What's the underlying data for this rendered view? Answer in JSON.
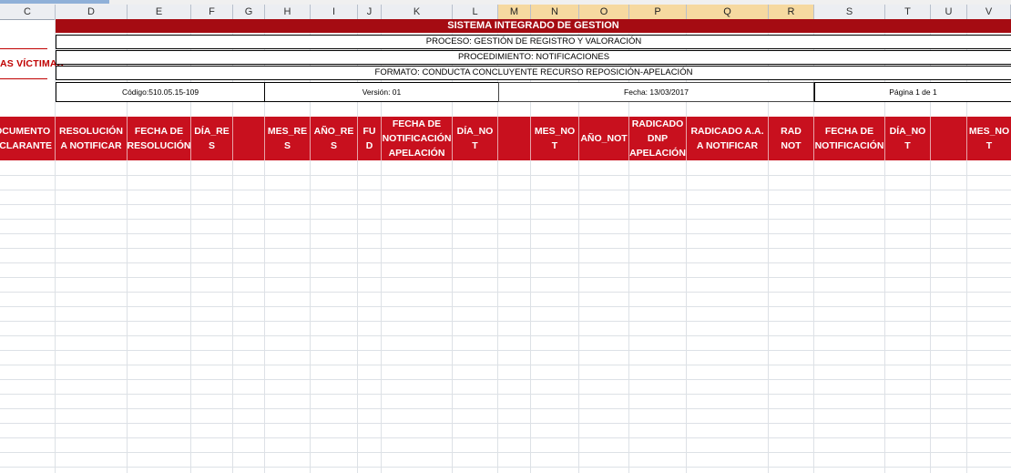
{
  "columns": [
    "C",
    "D",
    "E",
    "F",
    "G",
    "H",
    "I",
    "J",
    "K",
    "L",
    "M",
    "N",
    "O",
    "P",
    "Q",
    "R",
    "S",
    "T",
    "U",
    "V"
  ],
  "highlighted_columns": [
    "M",
    "N",
    "O",
    "P",
    "Q",
    "R"
  ],
  "logo": {
    "text": "AS VÍCTIMAS"
  },
  "header": {
    "title": "SISTEMA INTEGRADO DE GESTION",
    "proceso": "PROCESO: GESTIÓN DE REGISTRO Y VALORACIÓN",
    "procedimiento": "PROCEDIMIENTO: NOTIFICACIONES",
    "formato": "FORMATO: CONDUCTA CONCLUYENTE RECURSO REPOSICIÓN-APELACIÓN",
    "codigo": "Código:510.05.15-109",
    "version": "Versión: 01",
    "fecha": "Fecha: 13/03/2017",
    "pagina": "Página 1 de 1"
  },
  "table_headers": [
    "OCUMENTO\nECLARANTE",
    "RESOLUCIÓN\nA NOTIFICAR",
    "FECHA DE\nRESOLUCIÓN",
    "DÍA_RE\nS",
    "",
    "MES_RE\nS",
    "AÑO_RE\nS",
    "FU\nD",
    "FECHA DE\nNOTIFICACIÓN\nAPELACIÓN",
    "DÍA_NO\nT",
    "",
    "MES_NO\nT",
    "AÑO_NOT",
    "RADICADO\nDNP\nAPELACIÓN",
    "RADICADO A.A.\nA NOTIFICAR",
    "RAD\nNOT",
    "FECHA DE\nNOTIFICACIÓN",
    "DÍA_NO\nT",
    "",
    "MES_NO\nT"
  ],
  "colors": {
    "title_bg": "#a50b12",
    "header_bg": "#c8101e",
    "logo_red": "#c00000",
    "highlight_col": "#f6d9a0"
  }
}
